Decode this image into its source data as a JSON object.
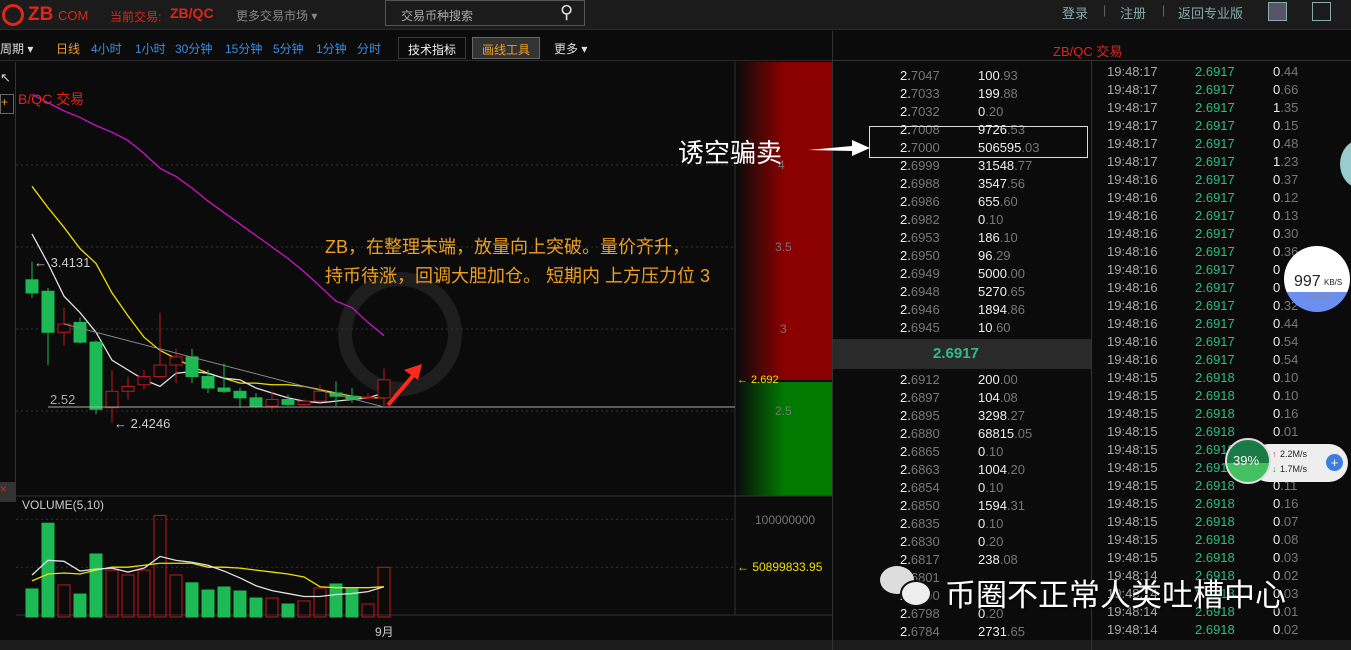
{
  "header": {
    "logo": "ZB",
    "logo_suffix": "COM",
    "current_label": "当前交易:",
    "current_pair": "ZB/QC",
    "more_markets": "更多交易市场",
    "search_placeholder": "交易币种搜索",
    "login": "登录",
    "register": "注册",
    "pro": "返回专业版",
    "sep": "|"
  },
  "toolbar": {
    "period": "周期",
    "intervals": [
      "日线",
      "4小时",
      "1小时",
      "30分钟",
      "15分钟",
      "5分钟",
      "1分钟",
      "分时"
    ],
    "indicators": "技术指标",
    "draw_tools": "画线工具",
    "more": "更多"
  },
  "chart": {
    "title": "B/QC 交易",
    "high_label": "← 3.4131",
    "low_label": "← 2.4246",
    "support_label": "2.52",
    "current_price_label": "← 2.692",
    "y_ticks": [
      "4",
      "3.5",
      "3",
      "2.5"
    ],
    "volume_title": "VOLUME(5,10)",
    "volume_ticks": [
      "100000000"
    ],
    "volume_current": "← 50899833.95",
    "x_label": "9月",
    "annotation_line1": "ZB，在整理末端，放量向上突破。量价齐升，",
    "annotation_line2": "持币待涨，回调大胆加仓。  短期内 上方压力位 3",
    "callout": "诱空骗卖"
  },
  "chart_data": {
    "type": "candlestick",
    "price_range": [
      2.4,
      4.5
    ],
    "ohlc": [
      [
        3.3,
        3.41,
        3.19,
        3.22
      ],
      [
        3.23,
        3.25,
        2.78,
        2.98
      ],
      [
        2.98,
        3.13,
        2.9,
        3.03
      ],
      [
        3.04,
        3.07,
        2.91,
        2.92
      ],
      [
        2.92,
        2.93,
        2.48,
        2.51
      ],
      [
        2.52,
        2.75,
        2.43,
        2.62
      ],
      [
        2.62,
        2.71,
        2.57,
        2.65
      ],
      [
        2.66,
        2.75,
        2.63,
        2.71
      ],
      [
        2.71,
        3.1,
        2.7,
        2.78
      ],
      [
        2.78,
        2.88,
        2.67,
        2.83
      ],
      [
        2.83,
        2.88,
        2.67,
        2.71
      ],
      [
        2.71,
        2.75,
        2.61,
        2.64
      ],
      [
        2.64,
        2.79,
        2.61,
        2.62
      ],
      [
        2.62,
        2.64,
        2.52,
        2.58
      ],
      [
        2.58,
        2.61,
        2.52,
        2.53
      ],
      [
        2.53,
        2.62,
        2.51,
        2.57
      ],
      [
        2.57,
        2.6,
        2.53,
        2.54
      ],
      [
        2.54,
        2.57,
        2.53,
        2.56
      ],
      [
        2.56,
        2.66,
        2.55,
        2.62
      ],
      [
        2.61,
        2.68,
        2.53,
        2.59
      ],
      [
        2.59,
        2.64,
        2.55,
        2.57
      ],
      [
        2.58,
        2.61,
        2.57,
        2.585
      ],
      [
        2.58,
        2.76,
        2.53,
        2.69
      ]
    ],
    "ma5": [
      3.58,
      3.4,
      3.2,
      3.1,
      2.98,
      2.81,
      2.75,
      2.69,
      2.65,
      2.73,
      2.74,
      2.73,
      2.7,
      2.69,
      2.64,
      2.61,
      2.58,
      2.56,
      2.55,
      2.56,
      2.57,
      2.58,
      2.61
    ],
    "ma10": [
      3.87,
      3.74,
      3.62,
      3.49,
      3.4,
      3.22,
      3.08,
      2.95,
      2.87,
      2.82,
      2.77,
      2.73,
      2.7,
      2.67,
      2.67,
      2.66,
      2.66,
      2.65,
      2.63,
      2.61,
      2.59,
      2.58,
      2.58
    ],
    "ma30": [
      4.43,
      4.38,
      4.33,
      4.29,
      4.24,
      4.2,
      4.15,
      4.07,
      3.98,
      3.93,
      3.86,
      3.78,
      3.71,
      3.64,
      3.57,
      3.5,
      3.43,
      3.35,
      3.26,
      3.17,
      3.13,
      3.04,
      2.96
    ],
    "volume": [
      28.7,
      96,
      32.8,
      23.5,
      64.5,
      48,
      43,
      48,
      104,
      43,
      35,
      27.6,
      30.7,
      26.6,
      19.4,
      19.4,
      13.3,
      16.4,
      29.7,
      33.8,
      28.7,
      13.3,
      50.9
    ],
    "vol_ma5": [
      43,
      58,
      57,
      47,
      49,
      50,
      46,
      50,
      62,
      58,
      56,
      53,
      47,
      40,
      32,
      27,
      24,
      21,
      21,
      23,
      24,
      26,
      31
    ],
    "vol_ma10": [
      37,
      44,
      45,
      44,
      48,
      51,
      51,
      53,
      55,
      55,
      55,
      51,
      51,
      50,
      48,
      46,
      44,
      41,
      31,
      30,
      30,
      30,
      31
    ],
    "volume_unit": "millions"
  },
  "orderbook": {
    "title": "ZB/QC 交易",
    "last_price": "2.6917",
    "asks": [
      [
        "2.",
        "7047",
        "100",
        ".93"
      ],
      [
        "2.",
        "7033",
        "199",
        ".88"
      ],
      [
        "2.",
        "7032",
        "0",
        ".20"
      ],
      [
        "2.",
        "7008",
        "9726",
        ".53"
      ],
      [
        "2.",
        "7000",
        "506595",
        ".03"
      ],
      [
        "2.",
        "6999",
        "31548",
        ".77"
      ],
      [
        "2.",
        "6988",
        "3547",
        ".56"
      ],
      [
        "2.",
        "6986",
        "655",
        ".60"
      ],
      [
        "2.",
        "6982",
        "0",
        ".10"
      ],
      [
        "2.",
        "6953",
        "186",
        ".10"
      ],
      [
        "2.",
        "6950",
        "96",
        ".29"
      ],
      [
        "2.",
        "6949",
        "5000",
        ".00"
      ],
      [
        "2.",
        "6948",
        "5270",
        ".65"
      ],
      [
        "2.",
        "6946",
        "1894",
        ".86"
      ],
      [
        "2.",
        "6945",
        "10",
        ".60"
      ]
    ],
    "bids": [
      [
        "2.",
        "6912",
        "200",
        ".00"
      ],
      [
        "2.",
        "6897",
        "104",
        ".08"
      ],
      [
        "2.",
        "6895",
        "3298",
        ".27"
      ],
      [
        "2.",
        "6880",
        "68815",
        ".05"
      ],
      [
        "2.",
        "6865",
        "0",
        ".10"
      ],
      [
        "2.",
        "6863",
        "1004",
        ".20"
      ],
      [
        "2.",
        "6854",
        "0",
        ".10"
      ],
      [
        "2.",
        "6850",
        "1594",
        ".31"
      ],
      [
        "2.",
        "6835",
        "0",
        ".10"
      ],
      [
        "2.",
        "6830",
        "0",
        ".20"
      ],
      [
        "2.",
        "6817",
        "238",
        ".08"
      ],
      [
        "2.",
        "6801",
        "",
        ""
      ],
      [
        "2.",
        "6800",
        "",
        ""
      ],
      [
        "2.",
        "6798",
        "0",
        ".20"
      ],
      [
        "2.",
        "6784",
        "2731",
        ".65"
      ]
    ]
  },
  "trades": [
    [
      "19:48:17",
      "2.6917",
      "0",
      ".44"
    ],
    [
      "19:48:17",
      "2.6917",
      "0",
      ".66"
    ],
    [
      "19:48:17",
      "2.6917",
      "1",
      ".35"
    ],
    [
      "19:48:17",
      "2.6917",
      "0",
      ".15"
    ],
    [
      "19:48:17",
      "2.6917",
      "0",
      ".48"
    ],
    [
      "19:48:17",
      "2.6917",
      "1",
      ".23"
    ],
    [
      "19:48:16",
      "2.6917",
      "0",
      ".37"
    ],
    [
      "19:48:16",
      "2.6917",
      "0",
      ".12"
    ],
    [
      "19:48:16",
      "2.6917",
      "0",
      ".13"
    ],
    [
      "19:48:16",
      "2.6917",
      "0",
      ".30"
    ],
    [
      "19:48:16",
      "2.6917",
      "0",
      ".36"
    ],
    [
      "19:48:16",
      "2.6917",
      "0",
      ""
    ],
    [
      "19:48:16",
      "2.6917",
      "0",
      ""
    ],
    [
      "19:48:16",
      "2.6917",
      "0",
      ".32"
    ],
    [
      "19:48:16",
      "2.6917",
      "0",
      ".44"
    ],
    [
      "19:48:16",
      "2.6917",
      "0",
      ".54"
    ],
    [
      "19:48:16",
      "2.6917",
      "0",
      ".54"
    ],
    [
      "19:48:15",
      "2.6918",
      "0",
      ".10"
    ],
    [
      "19:48:15",
      "2.6918",
      "0",
      ".10"
    ],
    [
      "19:48:15",
      "2.6918",
      "0",
      ".16"
    ],
    [
      "19:48:15",
      "2.6918",
      "0",
      ".01"
    ],
    [
      "19:48:15",
      "2.6918",
      "",
      ""
    ],
    [
      "19:48:15",
      "2.6918",
      "",
      ""
    ],
    [
      "19:48:15",
      "2.6918",
      "0",
      ".11"
    ],
    [
      "19:48:15",
      "2.6918",
      "0",
      ".16"
    ],
    [
      "19:48:15",
      "2.6918",
      "0",
      ".07"
    ],
    [
      "19:48:15",
      "2.6918",
      "0",
      ".08"
    ],
    [
      "19:48:15",
      "2.6918",
      "0",
      ".03"
    ],
    [
      "19:48:14",
      "2.6918",
      "0",
      ".02"
    ],
    [
      "19:48:14",
      "2.6918",
      "0",
      ".03"
    ],
    [
      "19:48:14",
      "2.6918",
      "0",
      ".01"
    ],
    [
      "19:48:14",
      "2.6918",
      "0",
      ".02"
    ]
  ],
  "widgets": {
    "speed": "997",
    "speed_unit": "KB/S",
    "speed_sub": "+0KB/s",
    "mem_percent": "39%",
    "up": "2.2M/s",
    "down": "1.7M/s"
  },
  "watermark": {
    "text": "币圈不正常人类吐槽中心"
  },
  "colors": {
    "up": "#c0191b",
    "down": "#1db954",
    "ma5": "#e0e0e0",
    "ma10": "#f0e000",
    "ma30": "#d010d0",
    "accent": "#f0a020",
    "trade_green": "#2dbd85"
  }
}
